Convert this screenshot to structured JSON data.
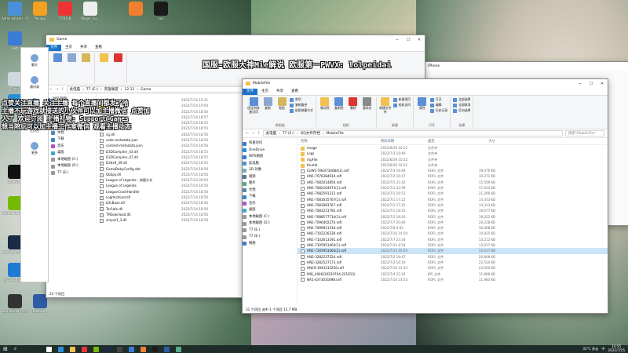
{
  "desktop": {
    "icons": [
      {
        "label": "Administrator - Personal",
        "color": "#4a90d9"
      },
      {
        "label": "Yesapp",
        "color": "#f4a020"
      },
      {
        "label": "TO9开发",
        "color": "#e33"
      },
      {
        "label": "Wager_eu...",
        "color": "#eee"
      },
      {
        "label": "",
        "color": "#f08030"
      },
      {
        "label": "nox",
        "color": "#1a1a1a"
      },
      {
        "label": "网络",
        "color": "#3b7bd6"
      },
      {
        "label": "回收站",
        "color": "#cfd8dc"
      },
      {
        "label": "Microsoft Edge",
        "color": "#2b8fd8"
      },
      {
        "label": "DMMGa...",
        "color": "#111"
      },
      {
        "label": "GeForce Experience",
        "color": "#76b900"
      },
      {
        "label": "ATP下载",
        "color": "#2d6ad6"
      },
      {
        "label": "League of Legends",
        "color": "#1b2a45"
      },
      {
        "label": "Microsoft Edge",
        "color": "#1f7bd2"
      },
      {
        "label": "OBS Studio - 37135",
        "color": "#333"
      },
      {
        "label": "TeamSp...",
        "color": "#2e5aa6"
      }
    ]
  },
  "overlay": {
    "top": "国服-欧服大神Mie解说 欧服第一PWVX: lolpeidai",
    "lines": [
      "点赞关注直播 关注主播 每个直播间都发了哈",
      "主播不玩游戏就接送的小伙伴可以加主播微信 点赞加",
      "入了 欢迎订阅 主播礼物: Support@Games",
      "想当陪玩可以加主播工作室微信 观看主播动态"
    ]
  },
  "sidebar_strip": [
    "聊天",
    "通讯录",
    "行文",
    "工作台",
    "更多"
  ],
  "window1": {
    "title": "Game",
    "tabs": [
      "文件",
      "主页",
      "共享",
      "查看"
    ],
    "file_tab": "文件",
    "path": [
      "此电脑",
      "T7 (E:)",
      "英雄联盟",
      "12.12",
      "Game"
    ],
    "status": "23 个项目",
    "nav": [
      {
        "label": "WPS网盘",
        "color": "#2f7be0"
      },
      {
        "label": "此电脑",
        "color": "#4a90d9"
      },
      {
        "label": "3D 对象",
        "color": "#7ab"
      },
      {
        "label": "视频",
        "color": "#579"
      },
      {
        "label": "图片",
        "color": "#5a8"
      },
      {
        "label": "文档",
        "color": "#58a"
      },
      {
        "label": "下载",
        "color": "#38c"
      },
      {
        "label": "音乐",
        "color": "#a5c"
      },
      {
        "label": "桌面",
        "color": "#4ac"
      },
      {
        "label": "本地磁盘 (C:)",
        "color": "#999"
      },
      {
        "label": "本地磁盘 (D:)",
        "color": "#999"
      },
      {
        "label": "T7 (E:)",
        "color": "#999"
      }
    ],
    "files": [
      {
        "name": "Config",
        "date": "2022/7/14 19:31",
        "kind": "folder"
      },
      {
        "name": "DATA",
        "date": "2022/7/14 19:04",
        "kind": "folder"
      },
      {
        "name": "Logs",
        "date": "2022/7/14 18:56",
        "kind": "folder"
      },
      {
        "name": "ACE-Helper",
        "date": "2022/7/14 18:57",
        "kind": "dll"
      },
      {
        "name": "BugTrace.dll",
        "date": "2022/7/14 18:55",
        "kind": "dll"
      },
      {
        "name": "BugTrace",
        "date": "2022/7/14 18:55",
        "kind": "file"
      },
      {
        "name": "cg.dll",
        "date": "2022/7/14 18:56",
        "kind": "dll"
      },
      {
        "name": "code-metadata.json",
        "date": "2022/7/14 18:56",
        "kind": "file"
      },
      {
        "name": "content-metadata.json",
        "date": "2022/7/14 18:56",
        "kind": "file"
      },
      {
        "name": "D3DCompiler_43.dll",
        "date": "2022/7/14 18:55",
        "kind": "dll"
      },
      {
        "name": "D3DCompiler_47.dll",
        "date": "2022/7/14 18:55",
        "kind": "dll"
      },
      {
        "name": "D3dx9_39.dll",
        "date": "2022/7/14 18:55",
        "kind": "dll"
      },
      {
        "name": "GameBabyConfig.dat",
        "date": "2022/7/14 18:56",
        "kind": "file"
      },
      {
        "name": "GbSpy.dll",
        "date": "2022/7/14 18:56",
        "kind": "dll"
      },
      {
        "name": "League of Legends - 快捷方式",
        "date": "2022/7/14 20:03",
        "kind": "file"
      },
      {
        "name": "League of Legends",
        "date": "2022/7/14 18:56",
        "kind": "file"
      },
      {
        "name": "LeagueCrashHandler",
        "date": "2022/7/14 18:56",
        "kind": "file"
      },
      {
        "name": "LogitechLed.dll",
        "date": "2022/7/14 18:56",
        "kind": "dll"
      },
      {
        "name": "LOLBase.dll",
        "date": "2022/7/14 18:56",
        "kind": "dll"
      },
      {
        "name": "TerSafe.dll",
        "date": "2022/7/14 18:56",
        "kind": "dll"
      },
      {
        "name": "TPDownload.dll",
        "date": "2022/7/14 18:56",
        "kind": "dll"
      },
      {
        "name": "xinput1_3.dll",
        "date": "2022/7/14 18:56",
        "kind": "dll"
      }
    ]
  },
  "window2": {
    "title": "MobileFile",
    "tabs": [
      "文件",
      "主页",
      "共享",
      "查看"
    ],
    "file_tab": "文件",
    "path": [
      "此电脑",
      "T7 (E:)",
      "QQ文件存档",
      "MobileFile"
    ],
    "search_placeholder": "搜索\"MobileFile\"",
    "status": "31 个项目   选中 1 个项目  12.7 MB",
    "columns": {
      "name": "名称",
      "date": "修改日期",
      "type": "类型",
      "size": "大小"
    },
    "ribbon": {
      "groups": [
        {
          "name": "剪贴板",
          "buttons": [
            "固定到快速访问",
            "复制",
            "粘贴"
          ],
          "small": [
            "剪切",
            "复制路径",
            "粘贴快捷方式"
          ]
        },
        {
          "name": "组织",
          "buttons": [
            "移动到",
            "复制到",
            "删除",
            "重命名"
          ],
          "small": []
        },
        {
          "name": "新建",
          "buttons": [
            "新建文件夹"
          ],
          "small": [
            "新建项目",
            "轻松访问"
          ]
        },
        {
          "name": "打开",
          "buttons": [
            "属性"
          ],
          "small": [
            "打开",
            "编辑",
            "历史记录"
          ]
        },
        {
          "name": "选择",
          "buttons": [],
          "small": [
            "全部选择",
            "全部取消",
            "反向选择"
          ]
        }
      ]
    },
    "nav": [
      {
        "label": "快速访问",
        "color": "#3b7bd6"
      },
      {
        "label": "OneDrive",
        "color": "#2b8fd8"
      },
      {
        "label": "WPS网盘",
        "color": "#2f7be0"
      },
      {
        "label": "此电脑",
        "color": "#4a90d9"
      },
      {
        "label": "3D 对象",
        "color": "#7ab"
      },
      {
        "label": "视频",
        "color": "#579"
      },
      {
        "label": "图片",
        "color": "#5a8"
      },
      {
        "label": "文档",
        "color": "#58a"
      },
      {
        "label": "下载",
        "color": "#38c"
      },
      {
        "label": "音乐",
        "color": "#a5c"
      },
      {
        "label": "桌面",
        "color": "#4ac"
      },
      {
        "label": "本地磁盘 (C:)",
        "color": "#999"
      },
      {
        "label": "本地磁盘 (D:)",
        "color": "#999"
      },
      {
        "label": "T7 (E:)",
        "color": "#999"
      },
      {
        "label": "T7 (E:)",
        "color": "#999"
      },
      {
        "label": "网络",
        "color": "#3b7bd6"
      }
    ],
    "files": [
      {
        "name": "image",
        "date": "2022/6/29 10:22",
        "type": "文件夹",
        "size": "",
        "kind": "folder"
      },
      {
        "name": "Logs",
        "date": "2022/7/3 19:49",
        "type": "文件夹",
        "size": "",
        "kind": "folder"
      },
      {
        "name": "mpFile",
        "date": "2022/6/29 10:22",
        "type": "文件夹",
        "size": "",
        "kind": "folder"
      },
      {
        "name": "thumb",
        "date": "2022/6/29 10:22",
        "type": "文件夹",
        "size": "",
        "kind": "folder"
      },
      {
        "name": "EUW1-5943734084(2).rofl",
        "date": "2022/7/3 19:48",
        "type": "ROFL 文件",
        "size": "19,476 KB",
        "kind": "file"
      },
      {
        "name": "HN1-7076384010.rofl",
        "date": "2022/7/2 16:17",
        "type": "ROFL 文件",
        "size": "10,371 KB",
        "kind": "file"
      },
      {
        "name": "HN1-7082014856.rofl",
        "date": "2022/7/1 21:42",
        "type": "ROFL 文件",
        "size": "15,509 KB",
        "kind": "file"
      },
      {
        "name": "HN1-7082164073(1).rofl",
        "date": "2022/7/1 22:59",
        "type": "ROFL 文件",
        "size": "17,424 KB",
        "kind": "file"
      },
      {
        "name": "HN1-7082591212.rofl",
        "date": "2022/7/1 16:51",
        "type": "ROFL 文件",
        "size": "21,296 KB",
        "kind": "file"
      },
      {
        "name": "HN1-7083035767(1).rofl",
        "date": "2022/7/1 17:22",
        "type": "ROFL 文件",
        "size": "14,333 KB",
        "kind": "file"
      },
      {
        "name": "HN1-7083083767.rofl",
        "date": "2022/7/1 17:22",
        "type": "ROFL 文件",
        "size": "14,333 KB",
        "kind": "file"
      },
      {
        "name": "HN1-7083253792.rofl",
        "date": "2022/7/1 18:10",
        "type": "ROFL 文件",
        "size": "19,477 KB",
        "kind": "file"
      },
      {
        "name": "HN1-7088577714(1).rofl",
        "date": "2022/7/1 18:20",
        "type": "ROFL 文件",
        "size": "19,022 KB",
        "kind": "file"
      },
      {
        "name": "HN1-7096402274.rofl",
        "date": "2022/7/7 20:44",
        "type": "ROFL 文件",
        "size": "20,228 KB",
        "kind": "file"
      },
      {
        "name": "HN1-7099911534.rofl",
        "date": "2022/7/8 0:02",
        "type": "ROFL 文件",
        "size": "16,068 KB",
        "kind": "file"
      },
      {
        "name": "HN1-7102226330.rofl",
        "date": "2022/7/10 14:50",
        "type": "ROFL 文件",
        "size": "10,925 KB",
        "kind": "file"
      },
      {
        "name": "HN1-7102613191.rofl",
        "date": "2022/7/7 23:34",
        "type": "ROFL 文件",
        "size": "13,212 KB",
        "kind": "file"
      },
      {
        "name": "HN1-7105953402(1).rofl",
        "date": "2022/7/14 4:54",
        "type": "ROFL 文件",
        "size": "13,017 KB",
        "kind": "file"
      },
      {
        "name": "HN1-7105953402(2).rofl",
        "date": "2022/7/15 10:54",
        "type": "ROFL 文件",
        "size": "13,017 KB",
        "kind": "file",
        "selected": true
      },
      {
        "name": "HN2-3282237524.rofl",
        "date": "2022/7/2 18:47",
        "type": "ROFL 文件",
        "size": "20,808 KB",
        "kind": "file"
      },
      {
        "name": "HN2-3282527173.rofl",
        "date": "2022/7/3 16:19",
        "type": "ROFL 文件",
        "size": "22,534 KB",
        "kind": "file"
      },
      {
        "name": "HN19-1943133256.rofl",
        "date": "2022/7/10 15:43",
        "type": "ROFL 文件",
        "size": "22,000 KB",
        "kind": "file"
      },
      {
        "name": "IMG_4046(20220704-221613)",
        "date": "2022/7/4 22:16",
        "type": "JPG 文件",
        "size": "11,988 KB",
        "kind": "file"
      },
      {
        "name": "NA1-4373031698.rofl",
        "date": "2022/7/14 23:53",
        "type": "ROFL 文件",
        "size": "11,983 KB",
        "kind": "file"
      }
    ]
  },
  "window3": {
    "title": "iPhone"
  },
  "taskbar": {
    "weather": "32°C 多云",
    "ime": "中",
    "time": "10:55",
    "date": "2022/7/15",
    "app_colors": [
      "#ffffff",
      "#2b8fd8",
      "#f2c14e",
      "#e33",
      "#76b900",
      "#1b2a45",
      "#444",
      "#3b7bd6",
      "#f08030",
      "#1a1a1a",
      "#2e5aa6",
      "#5a8"
    ]
  }
}
